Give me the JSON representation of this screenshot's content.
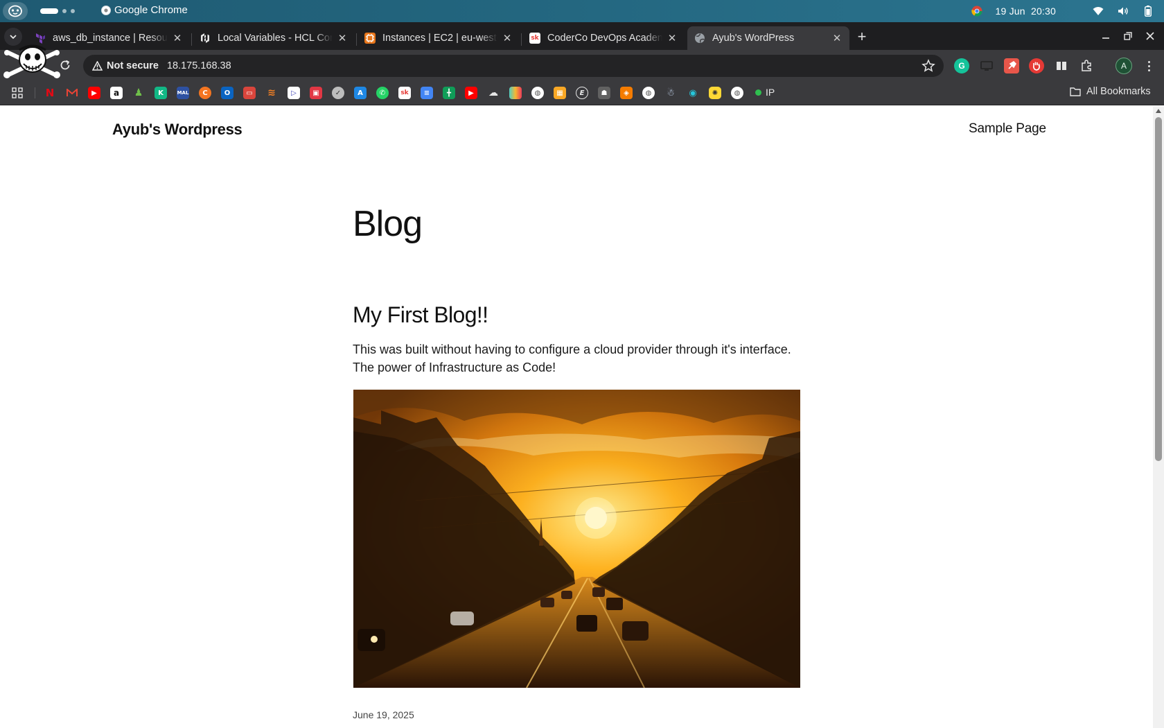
{
  "os_bar": {
    "app_name": "Google Chrome",
    "date": "19 Jun",
    "time": "20:30"
  },
  "tabs": [
    {
      "label": "aws_db_instance | Resou",
      "favicon": "terraform-icon",
      "color": "#7b42bc",
      "active": false
    },
    {
      "label": "Local Variables - HCL Con",
      "favicon": "hashicorp-icon",
      "color": "#e8e8e8",
      "active": false
    },
    {
      "label": "Instances | EC2 | eu-west-",
      "favicon": "aws-ec2-icon",
      "color": "#e8761b",
      "active": false
    },
    {
      "label": "CoderCo DevOps Acaden",
      "favicon": "skool-icon",
      "color": "#ffffff",
      "active": false
    },
    {
      "label": "Ayub's WordPress",
      "favicon": "globe-icon",
      "color": "#9aa0a6",
      "active": true
    }
  ],
  "toolbar": {
    "security_label": "Not secure",
    "url": "18.175.168.38",
    "profile_initial": "A"
  },
  "bookmarks": {
    "ip_label": "IP",
    "all_bookmarks_label": "All Bookmarks"
  },
  "page": {
    "site_title": "Ayub's Wordpress",
    "nav_link": "Sample Page",
    "heading": "Blog",
    "post": {
      "title": "My First Blog!!",
      "excerpt_line1": "This was built without having to configure a cloud provider through it's interface.",
      "excerpt_line2": "The power of Infrastructure as Code!",
      "date": "June 19, 2025"
    }
  },
  "colors": {
    "os_bar": "#23667f",
    "chrome_frame": "#1e1e20",
    "toolbar": "#3a3a3d",
    "omnibox": "#232325",
    "page_bg": "#ffffff",
    "text": "#111111"
  }
}
